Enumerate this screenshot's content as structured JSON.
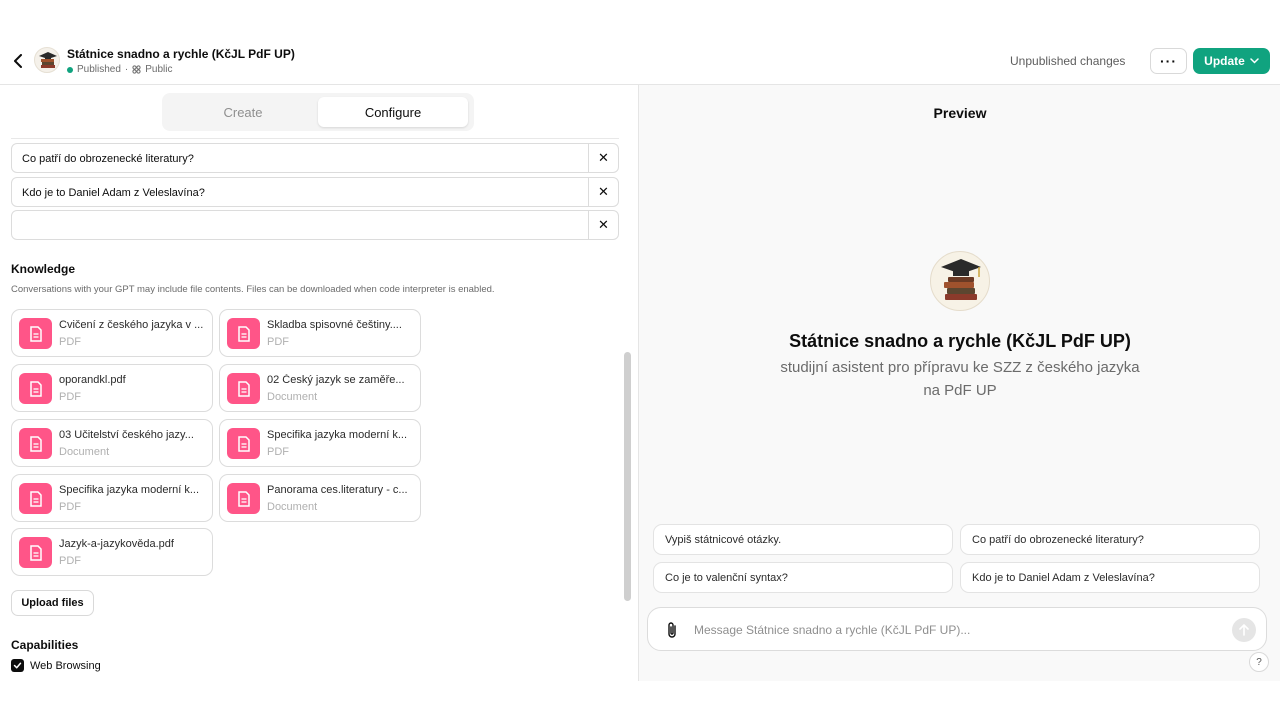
{
  "header": {
    "title": "Státnice snadno a rychle (KčJL PdF UP)",
    "status": "Published",
    "separator": "·",
    "visibility": "Public",
    "unpublished_changes": "Unpublished changes",
    "more_label": "···",
    "update_label": "Update"
  },
  "tabs": {
    "create": "Create",
    "configure": "Configure",
    "active": "configure"
  },
  "conversation_starters": [
    "Co patří do obrozenecké literatury?",
    "Kdo je to Daniel Adam z Veleslavína?",
    ""
  ],
  "knowledge": {
    "title": "Knowledge",
    "description": "Conversations with your GPT may include file contents. Files can be downloaded when code interpreter is enabled.",
    "files": [
      {
        "name": "Cvičení z českého jazyka v ...",
        "type": "PDF"
      },
      {
        "name": "Skladba spisovné češtiny....",
        "type": "PDF"
      },
      {
        "name": "oporandkl.pdf",
        "type": "PDF"
      },
      {
        "name": "02 Český jazyk se zaměře...",
        "type": "Document"
      },
      {
        "name": "03 Učitelství českého jazy...",
        "type": "Document"
      },
      {
        "name": "Specifika jazyka moderní k...",
        "type": "PDF"
      },
      {
        "name": "Specifika jazyka moderní k...",
        "type": "PDF"
      },
      {
        "name": "Panorama ces.literatury - c...",
        "type": "Document"
      },
      {
        "name": "Jazyk-a-jazykověda.pdf",
        "type": "PDF"
      }
    ],
    "upload_label": "Upload files"
  },
  "capabilities": {
    "title": "Capabilities",
    "web_browsing": {
      "label": "Web Browsing",
      "checked": true
    }
  },
  "preview": {
    "title": "Preview",
    "name": "Státnice snadno a rychle (KčJL PdF UP)",
    "description": "studijní asistent pro přípravu ke SZZ z českého jazyka na PdF UP",
    "suggestions": [
      "Vypiš státnicové otázky.",
      "Co patří do obrozenecké literatury?",
      "Co je to valenční syntax?",
      "Kdo je to Daniel Adam z Veleslavína?"
    ],
    "composer_placeholder": "Message Státnice snadno a rychle (KčJL PdF UP)...",
    "help_label": "?"
  },
  "colors": {
    "accent": "#10a37f",
    "file_icon": "#ff5588"
  }
}
